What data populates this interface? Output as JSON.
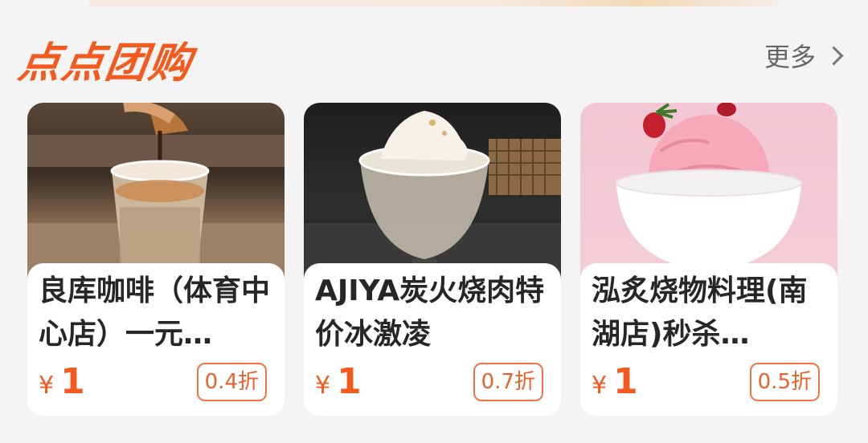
{
  "section": {
    "title": "点点团购",
    "more_label": "更多"
  },
  "cards": [
    {
      "name": "良库咖啡（体育中心店）一元…",
      "currency": "¥",
      "price": "1",
      "discount": "0.4折",
      "image": "iced-coffee-photo"
    },
    {
      "name": "AJIYA炭火烧肉特价冰激凌",
      "currency": "¥",
      "price": "1",
      "discount": "0.7折",
      "image": "soft-serve-ice-cream-photo"
    },
    {
      "name": "泓炙烧物料理(南湖店)秒杀…",
      "currency": "¥",
      "price": "1",
      "discount": "0.5折",
      "image": "strawberry-ice-cream-photo"
    }
  ],
  "colors": {
    "accent": "#f25a1e",
    "background": "#f4f4f4"
  }
}
